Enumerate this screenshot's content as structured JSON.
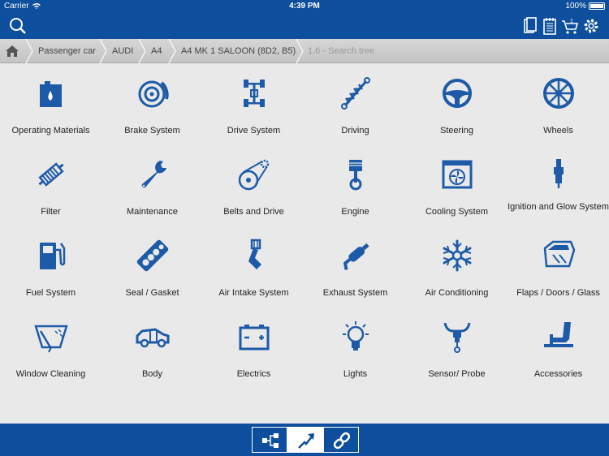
{
  "status": {
    "carrier": "Carrier",
    "time": "4:39 PM",
    "battery": "100%"
  },
  "breadcrumb": {
    "items": [
      "Passenger car",
      "AUDI",
      "A4",
      "A4 MK 1 SALOON (8D2, B5)"
    ],
    "current": "1.6 - Search tree"
  },
  "categories": [
    "Operating Materials",
    "Brake System",
    "Drive System",
    "Driving",
    "Steering",
    "Wheels",
    "Filter",
    "Maintenance",
    "Belts and Drive",
    "Engine",
    "Cooling System",
    "Ignition and Glow System",
    "Fuel System",
    "Seal / Gasket",
    "Air Intake System",
    "Exhaust System",
    "Air Conditioning",
    "Flaps / Doors / Glass",
    "Window Cleaning",
    "Body",
    "Electrics",
    "Lights",
    "Sensor/ Probe",
    "Accessories"
  ],
  "colors": {
    "brand": "#0d4f9c",
    "icon": "#1d5aa8",
    "background": "#e9e9e9"
  },
  "icons": {
    "toolbar": [
      "search-icon",
      "documents-icon",
      "notepad-icon",
      "cart-icon",
      "gear-icon"
    ],
    "footer": [
      "tree-icon",
      "trend-arrow-icon",
      "link-icon"
    ]
  }
}
